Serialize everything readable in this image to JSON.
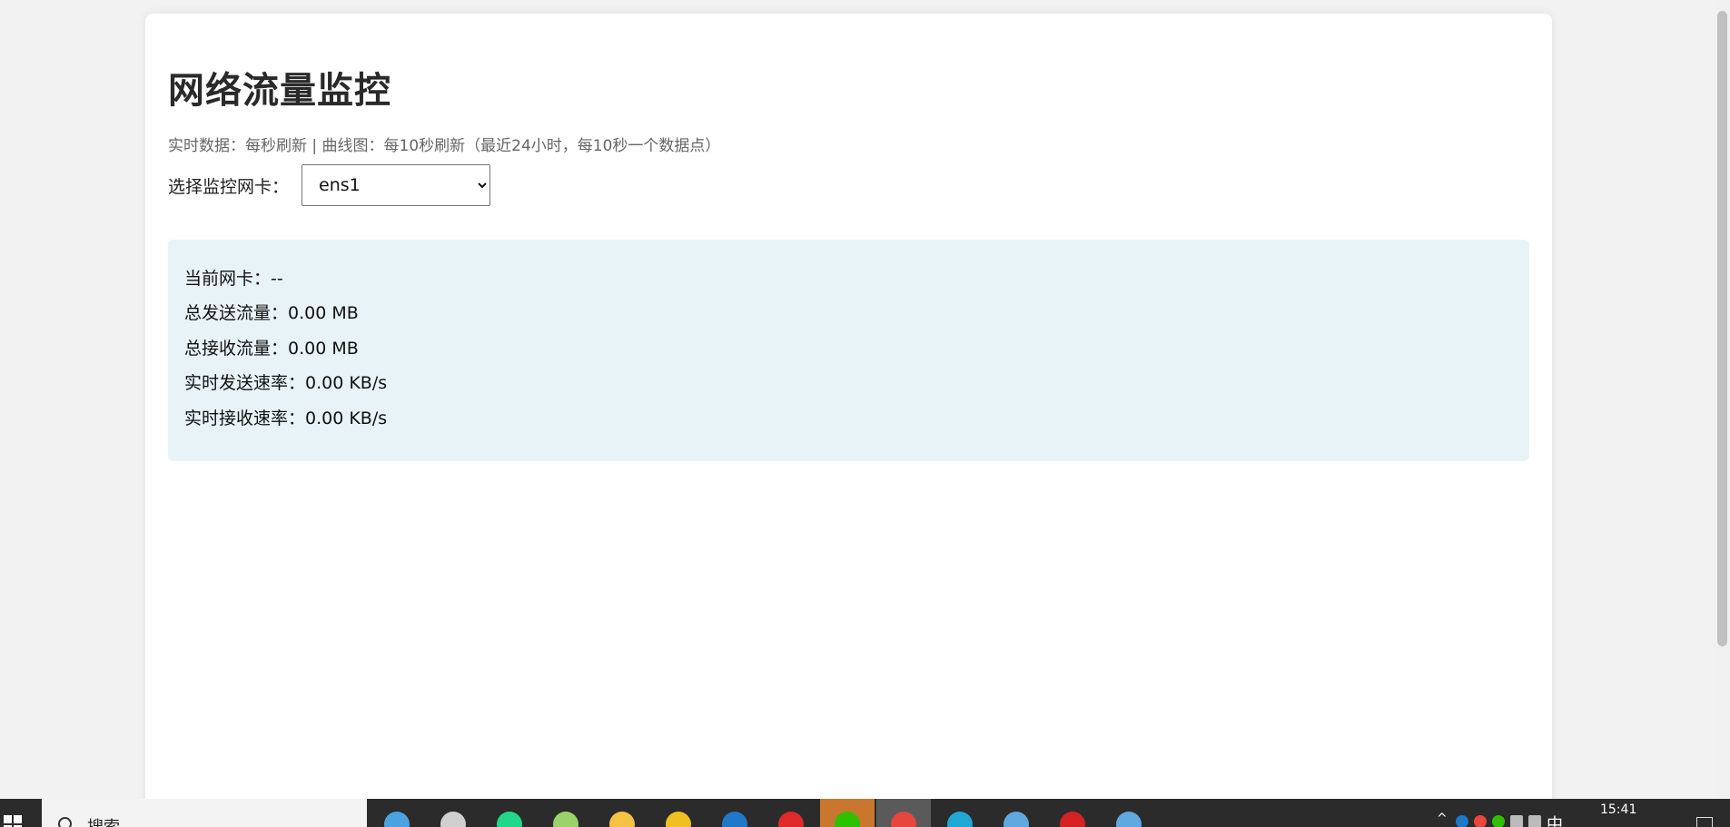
{
  "header": {
    "title": "网络流量监控",
    "subtitle": "实时数据：每秒刷新 | 曲线图：每10秒刷新（最近24小时，每10秒一个数据点）"
  },
  "nic_selector": {
    "label": "选择监控网卡：",
    "selected": "ens1"
  },
  "stats": {
    "current_nic": "当前网卡：--",
    "total_sent": "总发送流量：0.00 MB",
    "total_received": "总接收流量：0.00 MB",
    "send_rate": "实时发送速率：0.00 KB/s",
    "receive_rate": "实时接收速率：0.00 KB/s"
  },
  "taskbar": {
    "search_text": "搜索",
    "ime": "中",
    "time": "15:41",
    "apps": [
      {
        "icon": "lock-app-icon",
        "color": "#4aa3e0"
      },
      {
        "icon": "terminal-app-icon",
        "color": "#d0d0d0"
      },
      {
        "icon": "pycharm-app-icon",
        "color": "#21d789"
      },
      {
        "icon": "editor-app-icon",
        "color": "#9bd36a"
      },
      {
        "icon": "file-explorer-icon",
        "color": "#f5c242"
      },
      {
        "icon": "bt-app-icon",
        "color": "#f0c020"
      },
      {
        "icon": "k-app-icon",
        "color": "#1f79c9"
      },
      {
        "icon": "wps-app-icon",
        "color": "#e02a2a"
      },
      {
        "icon": "wechat-app-icon",
        "color": "#2dc100"
      },
      {
        "icon": "chrome-app-icon",
        "color": "#e8453c"
      },
      {
        "icon": "edge-app-icon",
        "color": "#1fa7d6"
      },
      {
        "icon": "remote-desktop-icon",
        "color": "#5fa8e0"
      },
      {
        "icon": "pdf-app-icon",
        "color": "#d42222"
      },
      {
        "icon": "network-app-icon",
        "color": "#5fa8e0"
      }
    ]
  },
  "colors": {
    "background": "#f2f2f2",
    "card": "#ffffff",
    "stats_panel": "#e8f3f8",
    "taskbar": "#2b2b2b"
  }
}
